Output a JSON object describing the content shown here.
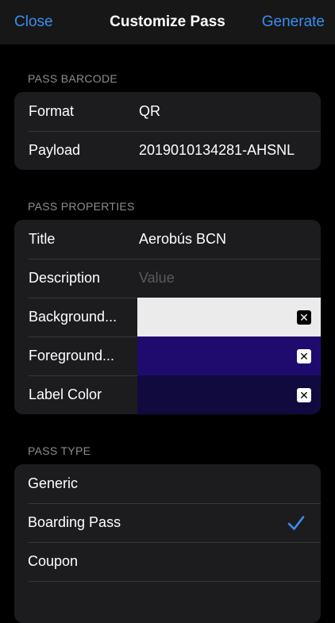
{
  "nav": {
    "close_label": "Close",
    "title": "Customize Pass",
    "generate_label": "Generate"
  },
  "barcode": {
    "header": "PASS BARCODE",
    "rows": [
      {
        "label": "Format",
        "value": "QR"
      },
      {
        "label": "Payload",
        "value": "2019010134281-AHSNL"
      }
    ]
  },
  "properties": {
    "header": "PASS PROPERTIES",
    "title": {
      "label": "Title",
      "value": "Aerobús BCN"
    },
    "description": {
      "label": "Description",
      "value": "",
      "placeholder": "Value"
    },
    "colors": [
      {
        "label": "Background...",
        "color": "#ebebeb",
        "clear_icon": "clear-x-icon",
        "clear_glyph": "✕"
      },
      {
        "label": "Foreground...",
        "color": "#1f0b6e",
        "clear_icon": "clear-x-icon",
        "clear_glyph": "✕"
      },
      {
        "label": "Label Color",
        "color": "#110a3e",
        "clear_icon": "clear-x-icon",
        "clear_glyph": "✕"
      }
    ]
  },
  "pass_type": {
    "header": "PASS TYPE",
    "options": [
      {
        "label": "Generic",
        "selected": false
      },
      {
        "label": "Boarding Pass",
        "selected": true
      },
      {
        "label": "Coupon",
        "selected": false
      }
    ]
  },
  "colors": {
    "accent": "#3a8ef0",
    "background": "#000000",
    "cell": "#1c1c1e",
    "nav": "#171717"
  }
}
